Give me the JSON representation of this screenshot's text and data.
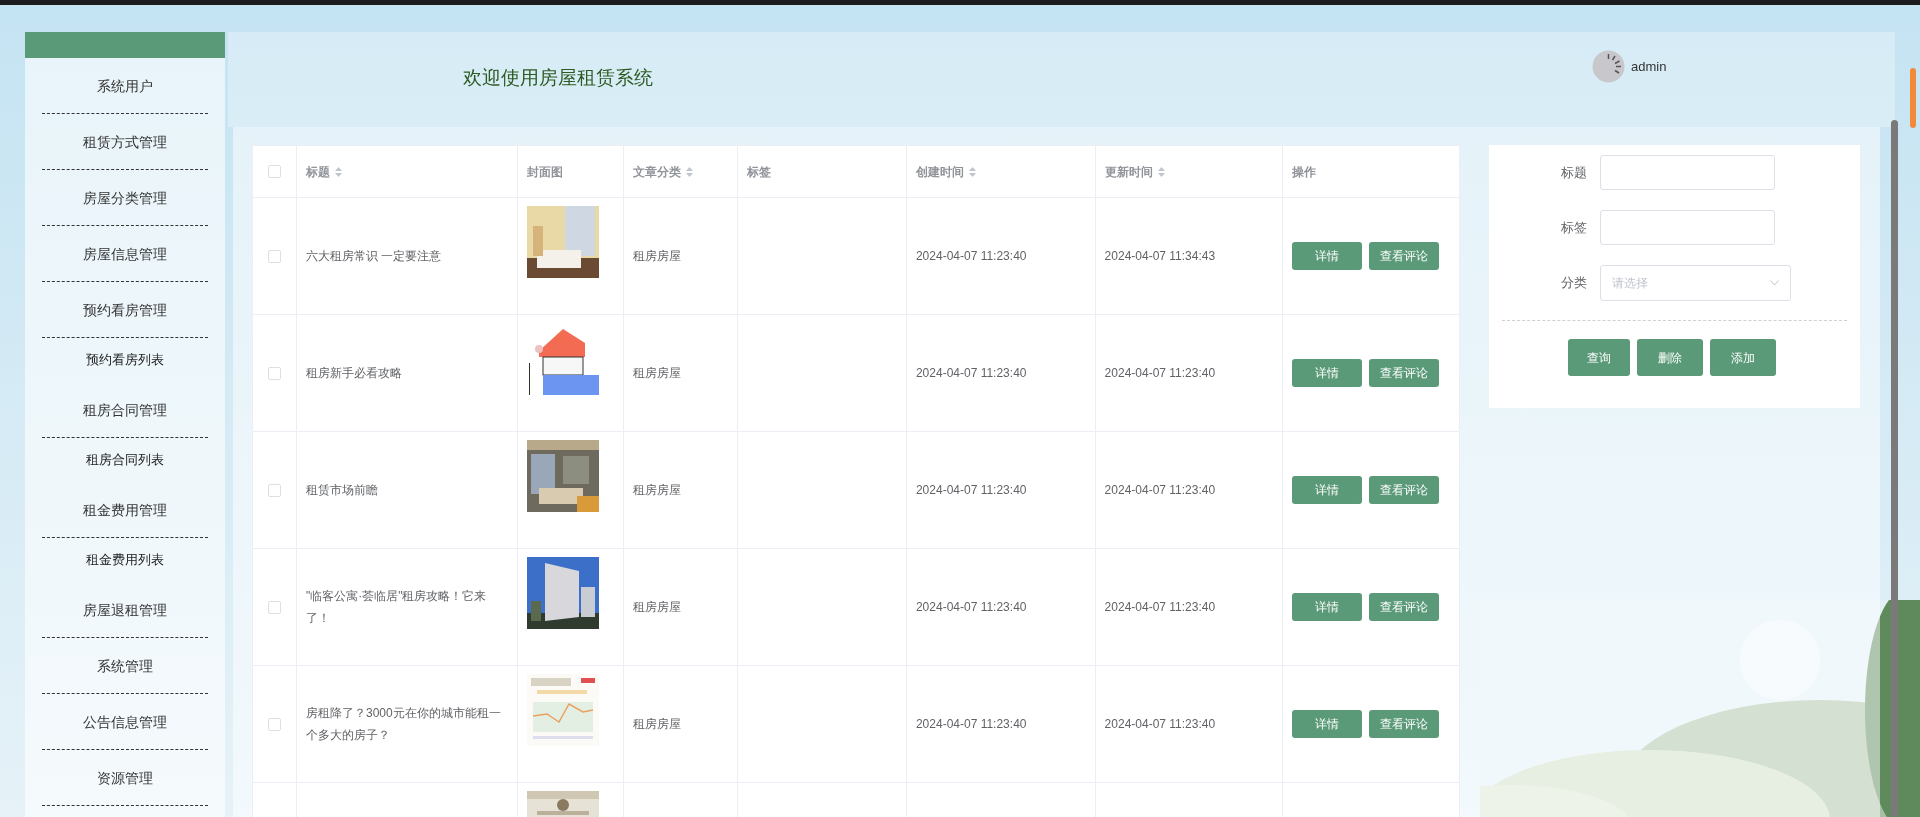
{
  "sidebar": {
    "items": [
      {
        "label": "系统用户",
        "kind": "group"
      },
      {
        "label": "租赁方式管理",
        "kind": "group"
      },
      {
        "label": "房屋分类管理",
        "kind": "group"
      },
      {
        "label": "房屋信息管理",
        "kind": "group"
      },
      {
        "label": "预约看房管理",
        "kind": "group"
      },
      {
        "label": "预约看房列表",
        "kind": "sub"
      },
      {
        "label": "租房合同管理",
        "kind": "group"
      },
      {
        "label": "租房合同列表",
        "kind": "sub"
      },
      {
        "label": "租金费用管理",
        "kind": "group"
      },
      {
        "label": "租金费用列表",
        "kind": "sub"
      },
      {
        "label": "房屋退租管理",
        "kind": "group"
      },
      {
        "label": "系统管理",
        "kind": "group"
      },
      {
        "label": "公告信息管理",
        "kind": "group"
      },
      {
        "label": "资源管理",
        "kind": "group"
      }
    ]
  },
  "header": {
    "title": "欢迎使用房屋租赁系统",
    "user": "admin"
  },
  "table": {
    "select_all": {
      "checked": false
    },
    "columns": [
      {
        "label": "标题",
        "sortable": true
      },
      {
        "label": "封面图",
        "sortable": false
      },
      {
        "label": "文章分类",
        "sortable": true
      },
      {
        "label": "标签",
        "sortable": false
      },
      {
        "label": "创建时间",
        "sortable": true
      },
      {
        "label": "更新时间",
        "sortable": true
      },
      {
        "label": "操作",
        "sortable": false
      }
    ],
    "rows": [
      {
        "checked": false,
        "title": "六大租房常识 一定要注意",
        "cover": {
          "kind": "picture"
        },
        "category": "租房房屋",
        "created": "2024-04-07 11:23:40",
        "updated": "2024-04-07 11:34:43",
        "actions": [
          "详情",
          "查看评论"
        ]
      },
      {
        "checked": false,
        "title": "租房新手必看攻略",
        "cover": {
          "kind": "picture"
        },
        "category": "租房房屋",
        "created": "2024-04-07 11:23:40",
        "updated": "2024-04-07 11:23:40",
        "actions": [
          "详情",
          "查看评论"
        ]
      },
      {
        "checked": false,
        "title": "租赁市场前瞻",
        "cover": {
          "kind": "picture"
        },
        "category": "租房房屋",
        "created": "2024-04-07 11:23:40",
        "updated": "2024-04-07 11:23:40",
        "actions": [
          "详情",
          "查看评论"
        ]
      },
      {
        "checked": false,
        "title": "\"临客公寓·荟临居\"租房攻略！它来了！",
        "cover": {
          "kind": "picture"
        },
        "category": "租房房屋",
        "created": "2024-04-07 11:23:40",
        "updated": "2024-04-07 11:23:40",
        "actions": [
          "详情",
          "查看评论"
        ]
      },
      {
        "checked": false,
        "title": "房租降了？3000元在你的城市能租一个多大的房子？",
        "cover": {
          "kind": "picture"
        },
        "category": "租房房屋",
        "created": "2024-04-07 11:23:40",
        "updated": "2024-04-07 11:23:40",
        "actions": [
          "详情",
          "查看评论"
        ]
      },
      {
        "cover": {
          "kind": "picture"
        }
      }
    ]
  },
  "search": {
    "fields": [
      {
        "label": "标题",
        "kind": "text"
      },
      {
        "label": "标签",
        "kind": "text"
      },
      {
        "label": "分类",
        "kind": "select",
        "placeholder": "请选择"
      }
    ],
    "buttons": [
      "查询",
      "删除",
      "添加"
    ]
  }
}
